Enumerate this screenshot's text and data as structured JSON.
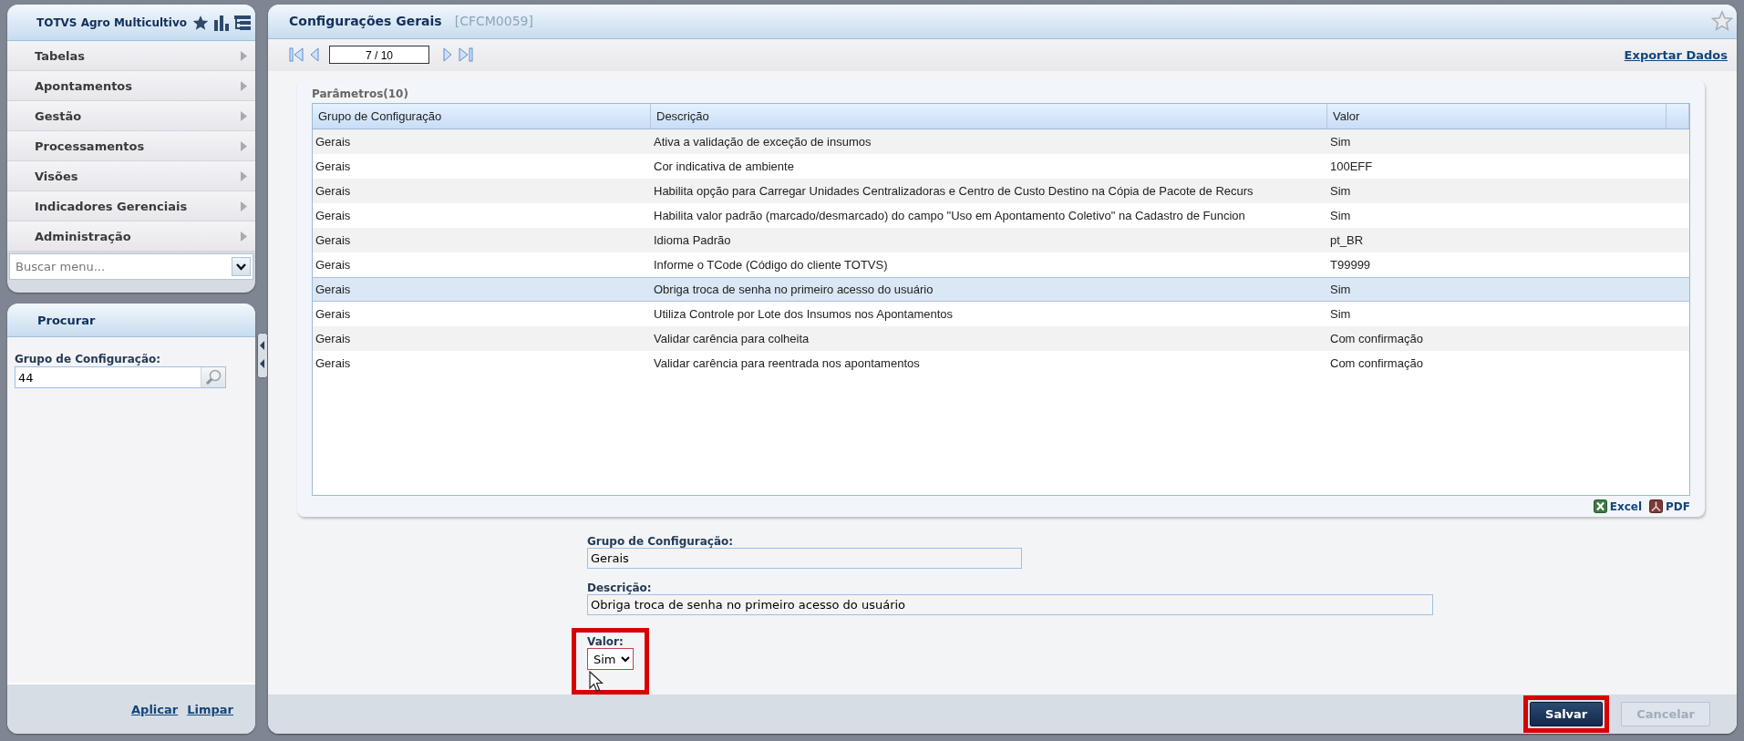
{
  "menu_panel": {
    "title": "TOTVS Agro Multicultivo",
    "items": [
      {
        "label": "Tabelas"
      },
      {
        "label": "Apontamentos"
      },
      {
        "label": "Gestão"
      },
      {
        "label": "Processamentos"
      },
      {
        "label": "Visões"
      },
      {
        "label": "Indicadores Gerenciais"
      },
      {
        "label": "Administração"
      }
    ],
    "search": {
      "placeholder": "Buscar menu..."
    }
  },
  "search_panel": {
    "title": "Procurar",
    "field_label": "Grupo de Configuração:",
    "field_value": "44",
    "links": [
      "Aplicar",
      "Limpar"
    ]
  },
  "main": {
    "title": "Configurações Gerais",
    "code": "[CFCM0059]",
    "pager": "7 / 10",
    "export_link": "Exportar Dados"
  },
  "table": {
    "caption": "Parâmetros(10)",
    "columns": [
      "Grupo de Configuração",
      "Descrição",
      "Valor"
    ],
    "rows": [
      {
        "cells": [
          "Gerais",
          "Ativa a validação de exceção de insumos",
          "Sim"
        ],
        "selected": false
      },
      {
        "cells": [
          "Gerais",
          "Cor indicativa de ambiente",
          "100EFF"
        ],
        "selected": false
      },
      {
        "cells": [
          "Gerais",
          "Habilita opção para Carregar Unidades Centralizadoras e Centro de Custo Destino na Cópia de Pacote de Recurs",
          "Sim"
        ],
        "selected": false
      },
      {
        "cells": [
          "Gerais",
          "Habilita valor padrão (marcado/desmarcado) do campo \"Uso em Apontamento Coletivo\" na Cadastro de Funcion",
          "Sim"
        ],
        "selected": false
      },
      {
        "cells": [
          "Gerais",
          "Idioma Padrão",
          "pt_BR"
        ],
        "selected": false
      },
      {
        "cells": [
          "Gerais",
          "Informe o TCode (Código do cliente TOTVS)",
          "T99999"
        ],
        "selected": false
      },
      {
        "cells": [
          "Gerais",
          "Obriga troca de senha no primeiro acesso do usuário",
          "Sim"
        ],
        "selected": true
      },
      {
        "cells": [
          "Gerais",
          "Utiliza Controle por Lote dos Insumos nos Apontamentos",
          "Sim"
        ],
        "selected": false
      },
      {
        "cells": [
          "Gerais",
          "Validar carência para colheita",
          "Com confirmação"
        ],
        "selected": false
      },
      {
        "cells": [
          "Gerais",
          "Validar carência para reentrada nos apontamentos",
          "Com confirmação"
        ],
        "selected": false
      }
    ],
    "exports": [
      {
        "kind": "excel",
        "label": "Excel"
      },
      {
        "kind": "pdf",
        "label": "PDF"
      }
    ]
  },
  "form": {
    "fields": [
      {
        "kind": "text",
        "label": "Grupo de Configuração:",
        "value": "Gerais",
        "highlighted": false
      },
      {
        "kind": "text",
        "label": "Descrição:",
        "value": "Obriga troca de senha no primeiro acesso do usuário",
        "highlighted": false
      },
      {
        "kind": "select",
        "label": "Valor:",
        "value": "Sim",
        "highlighted": true
      }
    ]
  },
  "buttons": [
    {
      "label": "Salvar",
      "disabled": false,
      "highlighted": true
    },
    {
      "label": "Cancelar",
      "disabled": true,
      "highlighted": false
    }
  ]
}
